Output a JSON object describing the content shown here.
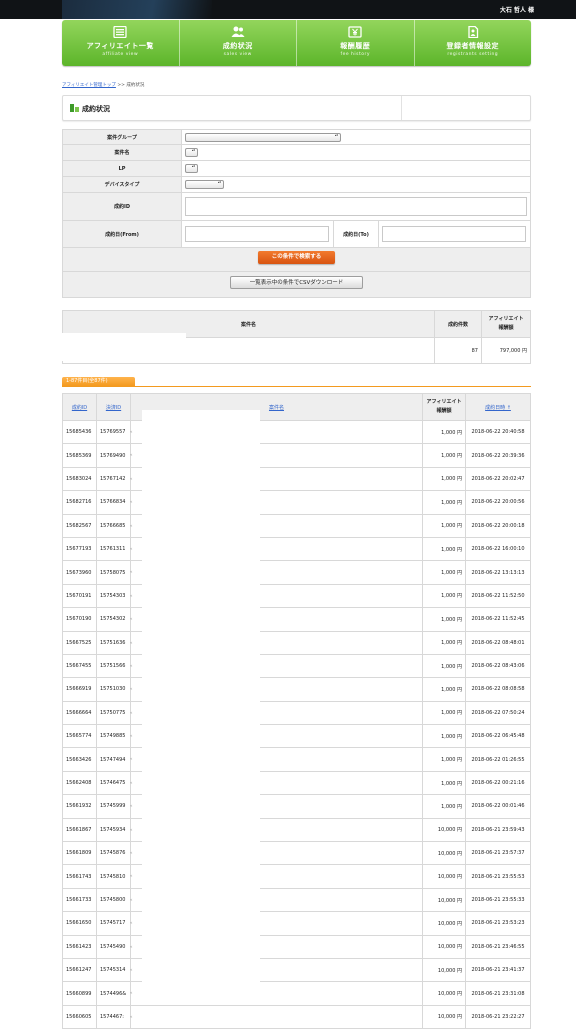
{
  "header": {
    "user_name": "大石 哲人 様"
  },
  "nav": [
    {
      "label": "アフィリエイト一覧",
      "sub": "affiliate view",
      "icon": "list-icon"
    },
    {
      "label": "成約状況",
      "sub": "sales view",
      "icon": "users-icon"
    },
    {
      "label": "報酬履歴",
      "sub": "fee history",
      "icon": "yen-icon"
    },
    {
      "label": "登録者情報設定",
      "sub": "registrants setting",
      "icon": "document-icon"
    }
  ],
  "breadcrumb": {
    "link": "アフィリエイト管理トップ",
    "separator": ">>",
    "current": "成約状況"
  },
  "page_title": "成約状況",
  "filter": {
    "group_label": "案件グループ",
    "name_label": "案件名",
    "lp_label": "LP",
    "device_label": "デバイスタイプ",
    "id_label": "成約ID",
    "from_label": "成約日(From)",
    "to_label": "成約日(To)",
    "search_button": "この条件で検索する",
    "csv_button": "一覧表示中の条件でCSVダウンロード"
  },
  "summary": {
    "headers": {
      "name": "案件名",
      "count": "成約件数",
      "fee_line1": "アフィリエイト",
      "fee_line2": "報酬額"
    },
    "row": {
      "count": "87",
      "fee": "797,000 円"
    }
  },
  "count_tab": "1-87件目(全87件)",
  "list": {
    "headers": {
      "id": "成約ID",
      "payment_id": "決済ID",
      "name": "案件名",
      "fee_line1": "アフィリエイト",
      "fee_line2": "報酬額",
      "date": "成約日時 ↑"
    },
    "rows": [
      {
        "id": "15685436",
        "pid": "15769557",
        "fee": "1,000 円",
        "date": "2018-06-22 20:40:58"
      },
      {
        "id": "15685369",
        "pid": "15769490",
        "fee": "1,000 円",
        "date": "2018-06-22 20:39:36"
      },
      {
        "id": "15683024",
        "pid": "15767142",
        "fee": "1,000 円",
        "date": "2018-06-22 20:02:47"
      },
      {
        "id": "15682716",
        "pid": "15766834",
        "fee": "1,000 円",
        "date": "2018-06-22 20:00:56"
      },
      {
        "id": "15682567",
        "pid": "15766685",
        "fee": "1,000 円",
        "date": "2018-06-22 20:00:18"
      },
      {
        "id": "15677193",
        "pid": "15761311",
        "fee": "1,000 円",
        "date": "2018-06-22 16:00:10"
      },
      {
        "id": "15673960",
        "pid": "15758075",
        "fee": "1,000 円",
        "date": "2018-06-22 13:13:13"
      },
      {
        "id": "15670191",
        "pid": "15754303",
        "fee": "1,000 円",
        "date": "2018-06-22 11:52:50"
      },
      {
        "id": "15670190",
        "pid": "15754302",
        "fee": "1,000 円",
        "date": "2018-06-22 11:52:45"
      },
      {
        "id": "15667525",
        "pid": "15751636",
        "fee": "1,000 円",
        "date": "2018-06-22 08:48:01"
      },
      {
        "id": "15667455",
        "pid": "15751566",
        "fee": "1,000 円",
        "date": "2018-06-22 08:43:06"
      },
      {
        "id": "15666919",
        "pid": "15751030",
        "fee": "1,000 円",
        "date": "2018-06-22 08:08:58"
      },
      {
        "id": "15666664",
        "pid": "15750775",
        "fee": "1,000 円",
        "date": "2018-06-22 07:50:24"
      },
      {
        "id": "15665774",
        "pid": "15749885",
        "fee": "1,000 円",
        "date": "2018-06-22 06:45:48"
      },
      {
        "id": "15663426",
        "pid": "15747494",
        "fee": "1,000 円",
        "date": "2018-06-22 01:26:55"
      },
      {
        "id": "15662408",
        "pid": "15746475",
        "fee": "1,000 円",
        "date": "2018-06-22 00:21:16"
      },
      {
        "id": "15661932",
        "pid": "15745999",
        "fee": "1,000 円",
        "date": "2018-06-22 00:01:46"
      },
      {
        "id": "15661867",
        "pid": "15745934",
        "fee": "10,000 円",
        "date": "2018-06-21 23:59:43"
      },
      {
        "id": "15661809",
        "pid": "15745876",
        "fee": "10,000 円",
        "date": "2018-06-21 23:57:37"
      },
      {
        "id": "15661743",
        "pid": "15745810",
        "fee": "10,000 円",
        "date": "2018-06-21 23:55:53"
      },
      {
        "id": "15661733",
        "pid": "15745800",
        "fee": "10,000 円",
        "date": "2018-06-21 23:55:33"
      },
      {
        "id": "15661650",
        "pid": "15745717",
        "fee": "10,000 円",
        "date": "2018-06-21 23:53:23"
      },
      {
        "id": "15661423",
        "pid": "15745490",
        "fee": "10,000 円",
        "date": "2018-06-21 23:46:55"
      },
      {
        "id": "15661247",
        "pid": "15745314",
        "fee": "10,000 円",
        "date": "2018-06-21 23:41:37"
      },
      {
        "id": "15660899",
        "pid": "1574496&",
        "fee": "10,000 円",
        "date": "2018-06-21 23:31:08"
      },
      {
        "id": "15660605",
        "pid": "1574467:",
        "fee": "10,000 円",
        "date": "2018-06-21 23:22:27"
      }
    ]
  }
}
